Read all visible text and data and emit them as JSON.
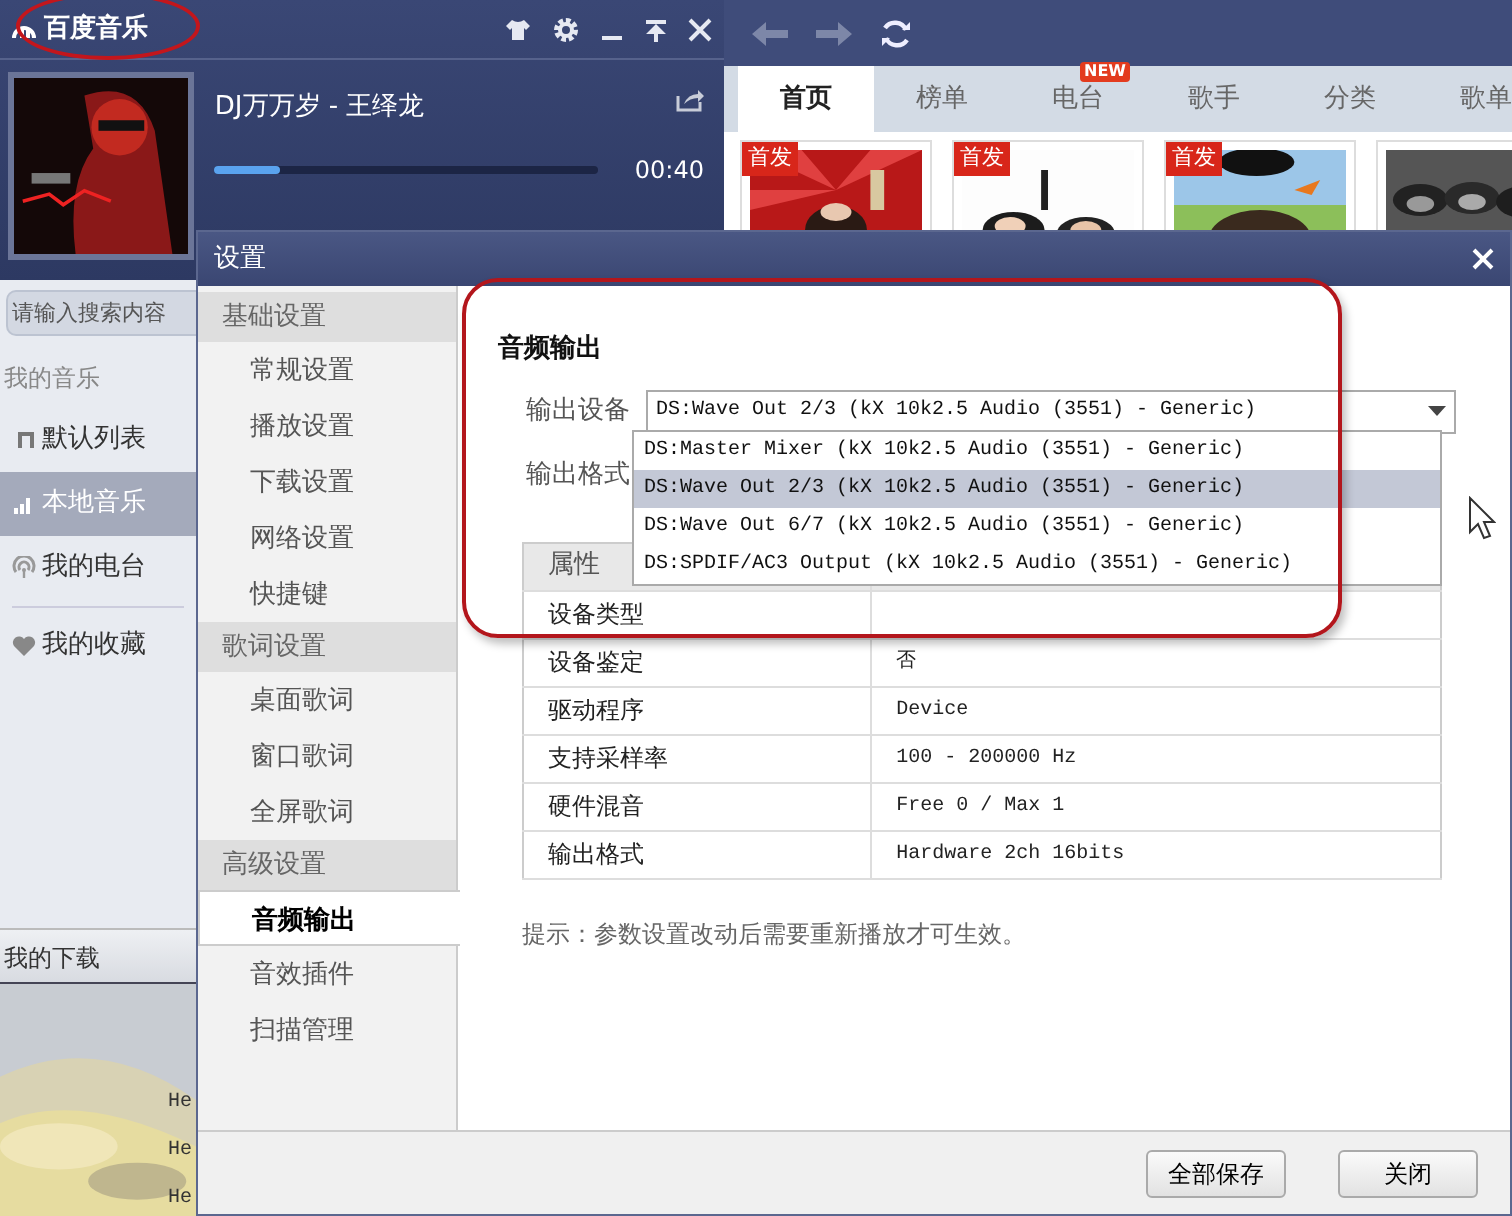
{
  "main_window": {
    "app_title": {
      "text": "百度音乐",
      "highlighted": true
    },
    "now_playing": {
      "song": "DJ万万岁 - 王绎龙",
      "time": "00:40",
      "level": 0.17
    },
    "browser": {
      "tabs": [
        {
          "label": "首页",
          "selected": true
        },
        {
          "label": "榜单",
          "selected": false
        },
        {
          "label": "电台",
          "selected": false,
          "badge": "NEW"
        },
        {
          "label": "歌手",
          "selected": false
        },
        {
          "label": "分类",
          "selected": false
        },
        {
          "label": "歌单",
          "selected": false
        }
      ],
      "tiles": [
        {
          "kind": "picture",
          "badge": "首发"
        },
        {
          "kind": "picture",
          "badge": "首发"
        },
        {
          "kind": "picture",
          "badge": "首发"
        },
        {
          "kind": "picture"
        }
      ]
    },
    "sidebar": {
      "search": {
        "placeholder": "请输入搜索内容"
      },
      "section": "我的音乐",
      "items": [
        {
          "label": "默认列表",
          "kind": "note",
          "selected": false,
          "divider_before": false
        },
        {
          "label": "本地音乐",
          "kind": "bars",
          "selected": true,
          "divider_before": false
        },
        {
          "label": "我的电台",
          "kind": "radio",
          "selected": false,
          "divider_before": false
        },
        {
          "label": "我的收藏",
          "kind": "heart",
          "selected": false,
          "divider_before": true
        }
      ],
      "downloads": "我的下载",
      "list": [
        "He",
        "He",
        "He"
      ]
    }
  },
  "dialog": {
    "title": "设置",
    "nav": [
      {
        "group": "基础设置",
        "items": [
          {
            "label": "常规设置",
            "selected": false
          },
          {
            "label": "播放设置",
            "selected": false
          },
          {
            "label": "下载设置",
            "selected": false
          },
          {
            "label": "网络设置",
            "selected": false
          },
          {
            "label": "快捷键",
            "selected": false
          }
        ]
      },
      {
        "group": "歌词设置",
        "items": [
          {
            "label": "桌面歌词",
            "selected": false
          },
          {
            "label": "窗口歌词",
            "selected": false
          },
          {
            "label": "全屏歌词",
            "selected": false
          }
        ]
      },
      {
        "group": "高级设置",
        "items": [
          {
            "label": "音频输出",
            "selected": true
          },
          {
            "label": "音效插件",
            "selected": false
          },
          {
            "label": "扫描管理",
            "selected": false
          }
        ]
      }
    ],
    "section": {
      "title": "音频输出",
      "highlighted": true,
      "fields": [
        {
          "label": "输出设备",
          "value": "DS:Wave Out 2/3 (kX 10k2.5 Audio (3551) - Generic)",
          "expanded": true
        },
        {
          "label": "输出格式"
        }
      ],
      "options": [
        {
          "label": "DS:Master Mixer (kX 10k2.5 Audio (3551) - Generic)",
          "selected": false
        },
        {
          "label": "DS:Wave Out 2/3 (kX 10k2.5 Audio (3551) - Generic)",
          "selected": true
        },
        {
          "label": "DS:Wave Out 6/7 (kX 10k2.5 Audio (3551) - Generic)",
          "selected": false
        },
        {
          "label": "DS:SPDIF/AC3 Output (kX 10k2.5 Audio (3551) - Generic)",
          "selected": false
        }
      ]
    },
    "table": {
      "columns": [
        "属性"
      ],
      "rows": [
        {
          "property": "设备类型"
        },
        {
          "property": "设备鉴定",
          "value": "否"
        },
        {
          "property": "驱动程序",
          "value": "Device"
        },
        {
          "property": "支持采样率",
          "value": "100 - 200000 Hz"
        },
        {
          "property": "硬件混音",
          "value": "Free 0 / Max 1"
        },
        {
          "property": "输出格式",
          "value": "Hardware 2ch 16bits"
        }
      ]
    },
    "hint": "提示：参数设置改动后需要重新播放才可生效。",
    "buttons": [
      "全部保存",
      "关闭"
    ]
  }
}
